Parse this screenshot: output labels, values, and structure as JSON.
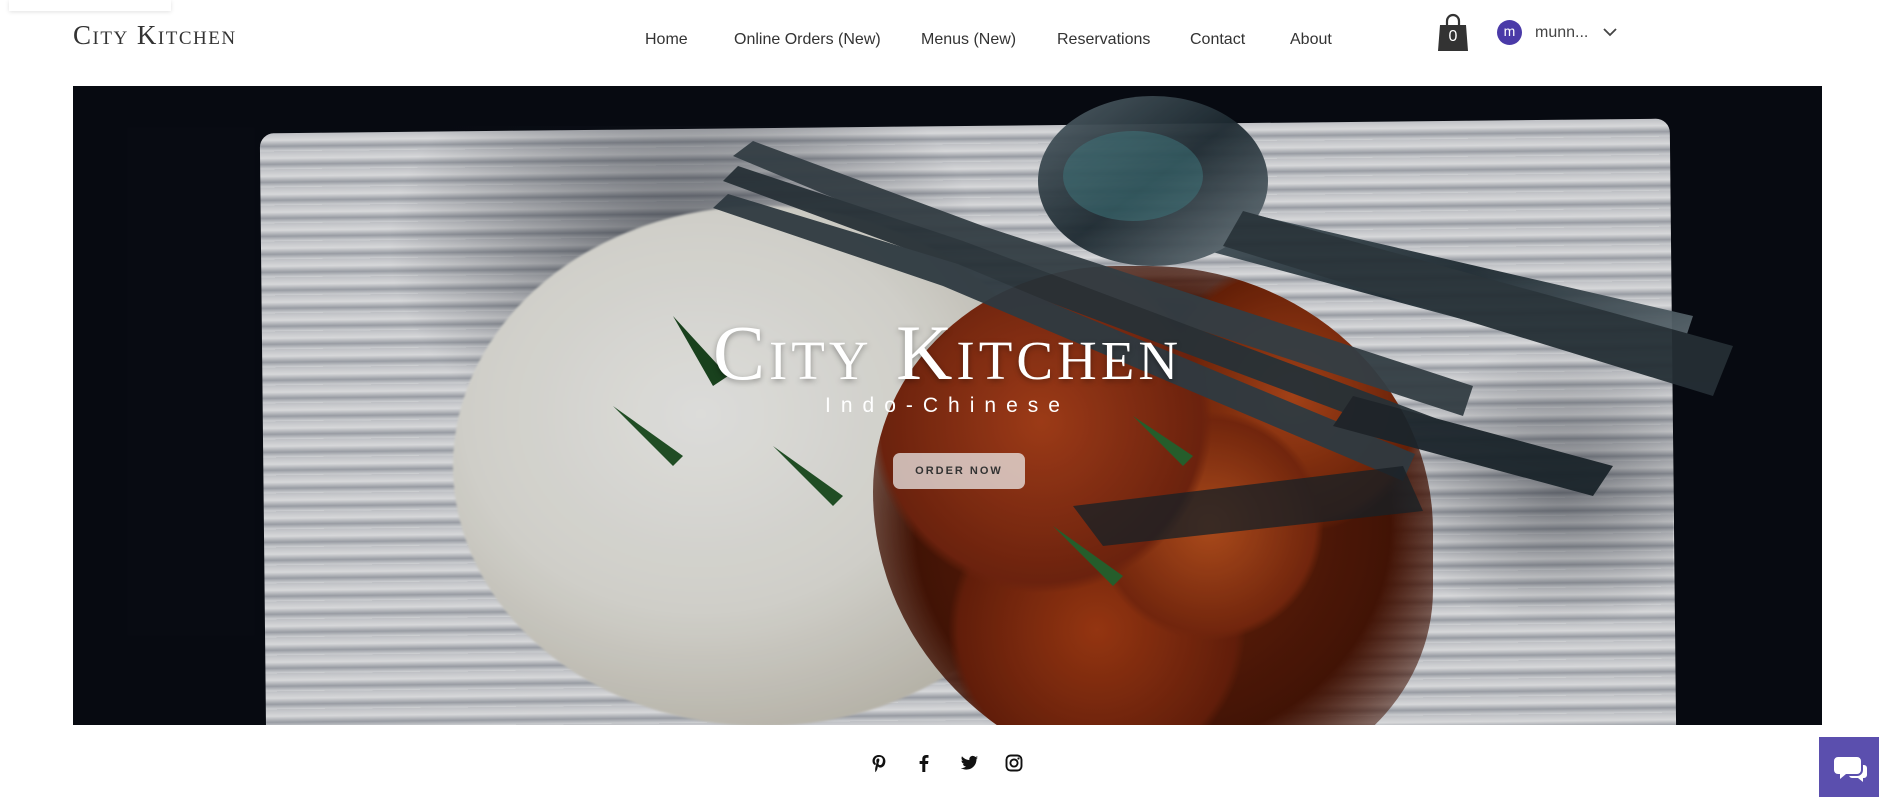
{
  "header": {
    "logo": "City Kitchen",
    "nav": [
      {
        "label": "Home"
      },
      {
        "label": "Online Orders (New)"
      },
      {
        "label": "Menus (New)"
      },
      {
        "label": "Reservations"
      },
      {
        "label": "Contact"
      },
      {
        "label": "About"
      }
    ],
    "cart_count": "0",
    "account": {
      "initial": "m",
      "name": "munn..."
    }
  },
  "hero": {
    "title": "City Kitchen",
    "subtitle": "Indo-Chinese",
    "cta": "ORDER NOW"
  },
  "footer": {
    "social": [
      "pinterest-icon",
      "facebook-icon",
      "twitter-icon",
      "instagram-icon"
    ]
  },
  "colors": {
    "accent": "#5b4fae",
    "avatar": "#4a3aa8"
  },
  "icons": {
    "cart": "shopping-bag-icon",
    "chevron": "chevron-down-icon",
    "chat": "chat-bubble-icon"
  }
}
